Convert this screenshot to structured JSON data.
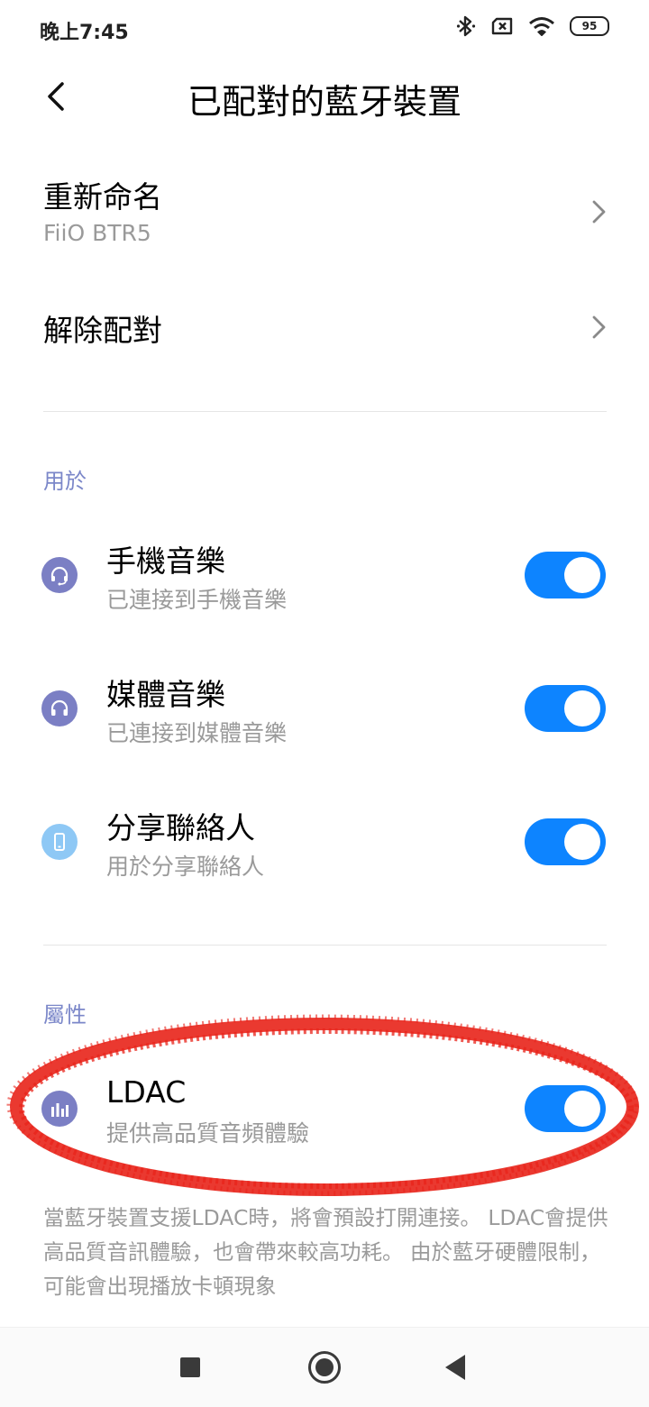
{
  "status_bar": {
    "time": "晚上7:45",
    "battery": "95"
  },
  "header": {
    "title": "已配對的藍牙裝置"
  },
  "rename": {
    "title": "重新命名",
    "subtitle": "FiiO BTR5"
  },
  "unpair": {
    "title": "解除配對"
  },
  "used_for": {
    "header": "用於",
    "items": [
      {
        "title": "手機音樂",
        "subtitle": "已連接到手機音樂",
        "enabled": true,
        "icon": "headset-mic-icon",
        "icon_color": "#7b7fc4"
      },
      {
        "title": "媒體音樂",
        "subtitle": "已連接到媒體音樂",
        "enabled": true,
        "icon": "headphones-icon",
        "icon_color": "#7b7fc4"
      },
      {
        "title": "分享聯絡人",
        "subtitle": "用於分享聯絡人",
        "enabled": true,
        "icon": "phone-icon",
        "icon_color": "#8ec8f5"
      }
    ]
  },
  "properties": {
    "header": "屬性",
    "ldac": {
      "title": "LDAC",
      "subtitle": "提供高品質音頻體驗",
      "enabled": true,
      "icon": "equalizer-bars-icon",
      "icon_color": "#7b7fc4"
    },
    "note": "當藍牙裝置支援LDAC時，將會預設打開連接。 LDAC會提供高品質音訊體驗，也會帶來較高功耗。 由於藍牙硬體限制，可能會出現播放卡頓現象"
  },
  "colors": {
    "accent": "#0d84ff",
    "section_header": "#7b87c9",
    "annotation": "#e8231a"
  }
}
